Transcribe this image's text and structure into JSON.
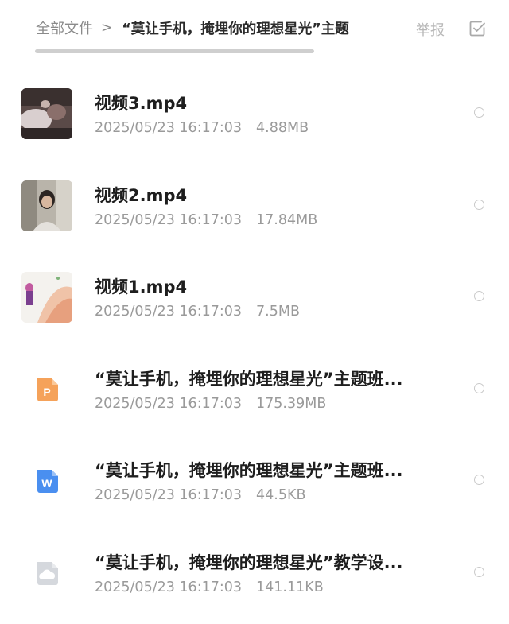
{
  "header": {
    "breadcrumb_root": "全部文件",
    "breadcrumb_separator": ">",
    "breadcrumb_current": "“莫让手机，掩埋你的理想星光”主题",
    "report_label": "举报",
    "select_icon": "checkbox-check-icon"
  },
  "files": [
    {
      "name": "视频3.mp4",
      "date": "2025/05/23 16:17:03",
      "size": "4.88MB",
      "icon": "video-thumbnail"
    },
    {
      "name": "视频2.mp4",
      "date": "2025/05/23 16:17:03",
      "size": "17.84MB",
      "icon": "video-thumbnail"
    },
    {
      "name": "视频1.mp4",
      "date": "2025/05/23 16:17:03",
      "size": "7.5MB",
      "icon": "video-thumbnail"
    },
    {
      "name": "“莫让手机，掩埋你的理想星光”主题班...",
      "date": "2025/05/23 16:17:03",
      "size": "175.39MB",
      "icon": "ppt-file-icon",
      "icon_letter": "P",
      "icon_color": "#F5A25A"
    },
    {
      "name": "“莫让手机，掩埋你的理想星光”主题班...",
      "date": "2025/05/23 16:17:03",
      "size": "44.5KB",
      "icon": "word-file-icon",
      "icon_letter": "W",
      "icon_color": "#4A8FF0"
    },
    {
      "name": "“莫让手机，掩埋你的理想星光”教学设...",
      "date": "2025/05/23 16:17:03",
      "size": "141.11KB",
      "icon": "cloud-file-icon",
      "icon_color": "#D5D8DD"
    }
  ]
}
